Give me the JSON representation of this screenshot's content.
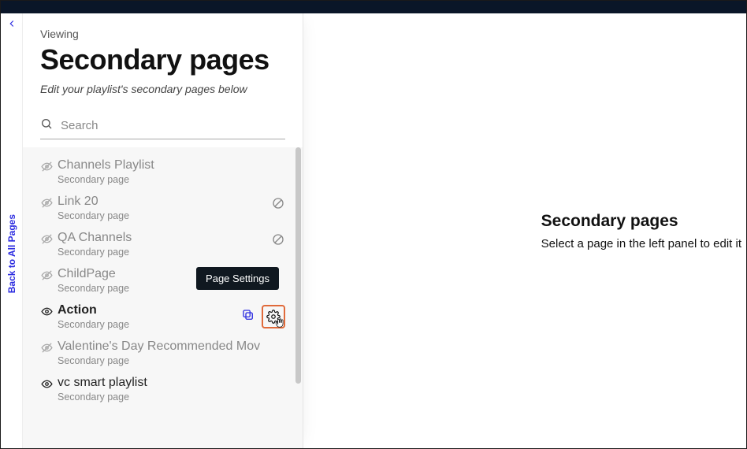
{
  "back_rail": {
    "label": "Back to All Pages"
  },
  "panel": {
    "viewing": "Viewing",
    "title": "Secondary pages",
    "subtitle": "Edit your playlist's secondary pages below"
  },
  "search": {
    "placeholder": "Search"
  },
  "tooltip": {
    "page_settings": "Page Settings"
  },
  "pages": [
    {
      "name": "Channels Playlist",
      "sub": "Secondary page",
      "visibility": "hidden",
      "blocked": false,
      "selected": false
    },
    {
      "name": "Link 20",
      "sub": "Secondary page",
      "visibility": "hidden",
      "blocked": true,
      "selected": false
    },
    {
      "name": "QA Channels",
      "sub": "Secondary page",
      "visibility": "hidden",
      "blocked": true,
      "selected": false
    },
    {
      "name": "ChildPage",
      "sub": "Secondary page",
      "visibility": "hidden",
      "blocked": false,
      "selected": false,
      "tooltip": true
    },
    {
      "name": "Action",
      "sub": "Secondary page",
      "visibility": "visible",
      "blocked": false,
      "selected": true,
      "actions": true
    },
    {
      "name": "Valentine's Day Recommended Mov",
      "sub": "Secondary page",
      "visibility": "hidden",
      "blocked": false,
      "selected": false
    },
    {
      "name": "vc smart playlist",
      "sub": "Secondary page",
      "visibility": "visible",
      "blocked": false,
      "selected": false
    }
  ],
  "right": {
    "title": "Secondary pages",
    "subtitle": "Select a page in the left panel to edit it"
  }
}
